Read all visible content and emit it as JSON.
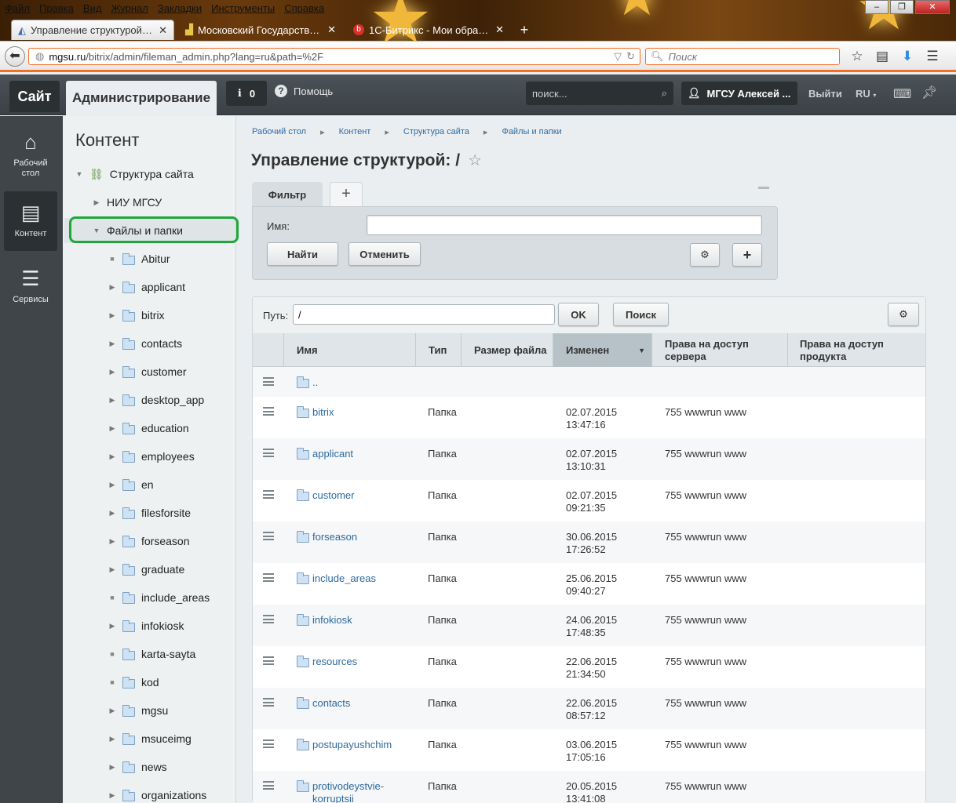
{
  "browser": {
    "menu": [
      "Файл",
      "Правка",
      "Вид",
      "Журнал",
      "Закладки",
      "Инструменты",
      "Справка"
    ],
    "tabs": [
      {
        "title": "Управление структурой: / ..."
      },
      {
        "title": "Московский Государстве..."
      },
      {
        "title": "1С-Битрикс - Мои обращ..."
      }
    ],
    "url_domain": "mgsu.ru",
    "url_path": "/bitrix/admin/fileman_admin.php?lang=ru&path=%2F",
    "search_placeholder": "Поиск",
    "new_tab": "+"
  },
  "panel": {
    "site_label": "Сайт",
    "admin_label": "Администрирование",
    "notif_count": "0",
    "help_label": "Помощь",
    "search_placeholder": "поиск...",
    "user_name": "МГСУ Алексей ...",
    "logout_label": "Выйти",
    "lang_label": "RU"
  },
  "leftnav": [
    {
      "label": "Рабочий стол",
      "icon": "home-icon"
    },
    {
      "label": "Контент",
      "icon": "document-icon"
    },
    {
      "label": "Сервисы",
      "icon": "layers-icon"
    }
  ],
  "tree": {
    "title": "Контент",
    "root": "Структура сайта",
    "nodes": [
      {
        "label": "НИУ МГСУ",
        "level": 1,
        "expandable": true
      },
      {
        "label": "Файлы и папки",
        "level": 1,
        "expanded": true
      },
      {
        "label": "Abitur",
        "level": 2,
        "expandable": false
      },
      {
        "label": "applicant",
        "level": 2,
        "expandable": true
      },
      {
        "label": "bitrix",
        "level": 2,
        "expandable": true
      },
      {
        "label": "contacts",
        "level": 2,
        "expandable": true
      },
      {
        "label": "customer",
        "level": 2,
        "expandable": true
      },
      {
        "label": "desktop_app",
        "level": 2,
        "expandable": true
      },
      {
        "label": "education",
        "level": 2,
        "expandable": true
      },
      {
        "label": "employees",
        "level": 2,
        "expandable": true
      },
      {
        "label": "en",
        "level": 2,
        "expandable": true
      },
      {
        "label": "filesforsite",
        "level": 2,
        "expandable": true
      },
      {
        "label": "forseason",
        "level": 2,
        "expandable": true
      },
      {
        "label": "graduate",
        "level": 2,
        "expandable": true
      },
      {
        "label": "include_areas",
        "level": 2,
        "expandable": false
      },
      {
        "label": "infokiosk",
        "level": 2,
        "expandable": true
      },
      {
        "label": "karta-sayta",
        "level": 2,
        "expandable": false
      },
      {
        "label": "kod",
        "level": 2,
        "expandable": false
      },
      {
        "label": "mgsu",
        "level": 2,
        "expandable": true
      },
      {
        "label": "msuceimg",
        "level": 2,
        "expandable": true
      },
      {
        "label": "news",
        "level": 2,
        "expandable": true
      },
      {
        "label": "organizations",
        "level": 2,
        "expandable": true
      }
    ]
  },
  "breadcrumb": [
    "Рабочий стол",
    "Контент",
    "Структура сайта",
    "Файлы и папки"
  ],
  "page_title": "Управление структурой: /",
  "filter": {
    "tab_label": "Фильтр",
    "name_label": "Имя:",
    "name_value": "",
    "find_label": "Найти",
    "cancel_label": "Отменить"
  },
  "grid": {
    "path_label": "Путь:",
    "path_value": "/",
    "ok_label": "OK",
    "search_label": "Поиск",
    "columns": [
      "Имя",
      "Тип",
      "Размер файла",
      "Изменен",
      "Права на доступ сервера",
      "Права на доступ продукта"
    ],
    "up_link": "..",
    "rows": [
      {
        "name": "bitrix",
        "type": "Папка",
        "date": "02.07.2015",
        "time": "13:47:16",
        "rights": "755 wwwrun www"
      },
      {
        "name": "applicant",
        "type": "Папка",
        "date": "02.07.2015",
        "time": "13:10:31",
        "rights": "755 wwwrun www"
      },
      {
        "name": "customer",
        "type": "Папка",
        "date": "02.07.2015",
        "time": "09:21:35",
        "rights": "755 wwwrun www"
      },
      {
        "name": "forseason",
        "type": "Папка",
        "date": "30.06.2015",
        "time": "17:26:52",
        "rights": "755 wwwrun www"
      },
      {
        "name": "include_areas",
        "type": "Папка",
        "date": "25.06.2015",
        "time": "09:40:27",
        "rights": "755 wwwrun www"
      },
      {
        "name": "infokiosk",
        "type": "Папка",
        "date": "24.06.2015",
        "time": "17:48:35",
        "rights": "755 wwwrun www"
      },
      {
        "name": "resources",
        "type": "Папка",
        "date": "22.06.2015",
        "time": "21:34:50",
        "rights": "755 wwwrun www"
      },
      {
        "name": "contacts",
        "type": "Папка",
        "date": "22.06.2015",
        "time": "08:57:12",
        "rights": "755 wwwrun www"
      },
      {
        "name": "postupayushchim",
        "type": "Папка",
        "date": "03.06.2015",
        "time": "17:05:16",
        "rights": "755 wwwrun www"
      },
      {
        "name": "protivodeystvie-korruptsii",
        "type": "Папка",
        "date": "20.05.2015",
        "time": "13:41:08",
        "rights": "755 wwwrun www"
      }
    ]
  },
  "colors": {
    "accent": "#f46e26",
    "link": "#2d6a9f",
    "panel": "#3f4548",
    "highlight_oval": "#1fa83a"
  }
}
